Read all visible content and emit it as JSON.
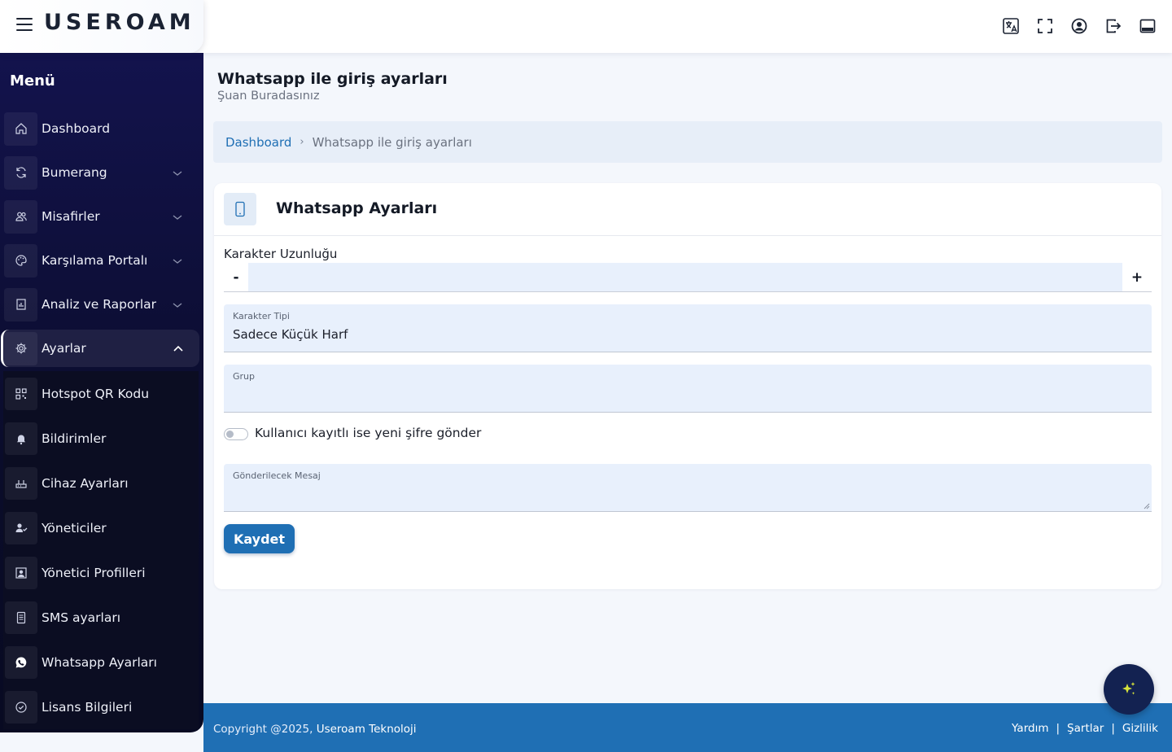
{
  "brand": {
    "logo_text": "USEROAM",
    "accent_color": "#d7e33b"
  },
  "header_icons": [
    "translate-icon",
    "fullscreen-icon",
    "user-circle-icon",
    "logout-icon",
    "panel-icon"
  ],
  "sidebar": {
    "title": "Menü",
    "items": [
      {
        "label": "Dashboard",
        "icon": "home-icon",
        "has_chevron": false
      },
      {
        "label": "Bumerang",
        "icon": "refresh-icon",
        "has_chevron": true
      },
      {
        "label": "Misafirler",
        "icon": "users-icon",
        "has_chevron": true
      },
      {
        "label": "Karşılama Portalı",
        "icon": "palette-icon",
        "has_chevron": true
      },
      {
        "label": "Analiz ve Raporlar",
        "icon": "report-icon",
        "has_chevron": true
      },
      {
        "label": "Ayarlar",
        "icon": "gear-icon",
        "has_chevron": true,
        "expanded": true
      }
    ],
    "submenu": [
      {
        "label": "Hotspot QR Kodu",
        "icon": "qr-code-icon"
      },
      {
        "label": "Bildirimler",
        "icon": "bell-icon"
      },
      {
        "label": "Cihaz Ayarları",
        "icon": "router-icon"
      },
      {
        "label": "Yöneticiler",
        "icon": "user-check-icon"
      },
      {
        "label": "Yönetici Profilleri",
        "icon": "profile-icon"
      },
      {
        "label": "SMS ayarları",
        "icon": "sms-icon"
      },
      {
        "label": "Whatsapp Ayarları",
        "icon": "whatsapp-icon"
      },
      {
        "label": "Lisans Bilgileri",
        "icon": "badge-check-icon"
      }
    ]
  },
  "page": {
    "title": "Whatsapp ile giriş ayarları",
    "subtitle": "Şuan Buradasınız"
  },
  "breadcrumb": {
    "home": "Dashboard",
    "current": "Whatsapp ile giriş ayarları"
  },
  "card": {
    "title": "Whatsapp Ayarları",
    "char_length": {
      "label": "Karakter Uzunluğu",
      "minus": "-",
      "plus": "+",
      "value": ""
    },
    "char_type": {
      "label": "Karakter Tipi",
      "value": "Sadece Küçük Harf"
    },
    "group": {
      "label": "Grup",
      "value": ""
    },
    "toggle": {
      "label": "Kullanıcı kayıtlı ise yeni şifre gönder",
      "checked": false
    },
    "message": {
      "label": "Gönderilecek Mesaj",
      "value": ""
    },
    "save_label": "Kaydet"
  },
  "footer": {
    "copyright": "Copyright @2025,",
    "company": "Useroam Teknoloji",
    "links": [
      "Yardım",
      "Şartlar",
      "Gizlilik"
    ],
    "separator": "|"
  },
  "colors": {
    "primary": "#1f6fb4",
    "sidebar": "#13134d",
    "input_bg": "#e8f0fc"
  }
}
